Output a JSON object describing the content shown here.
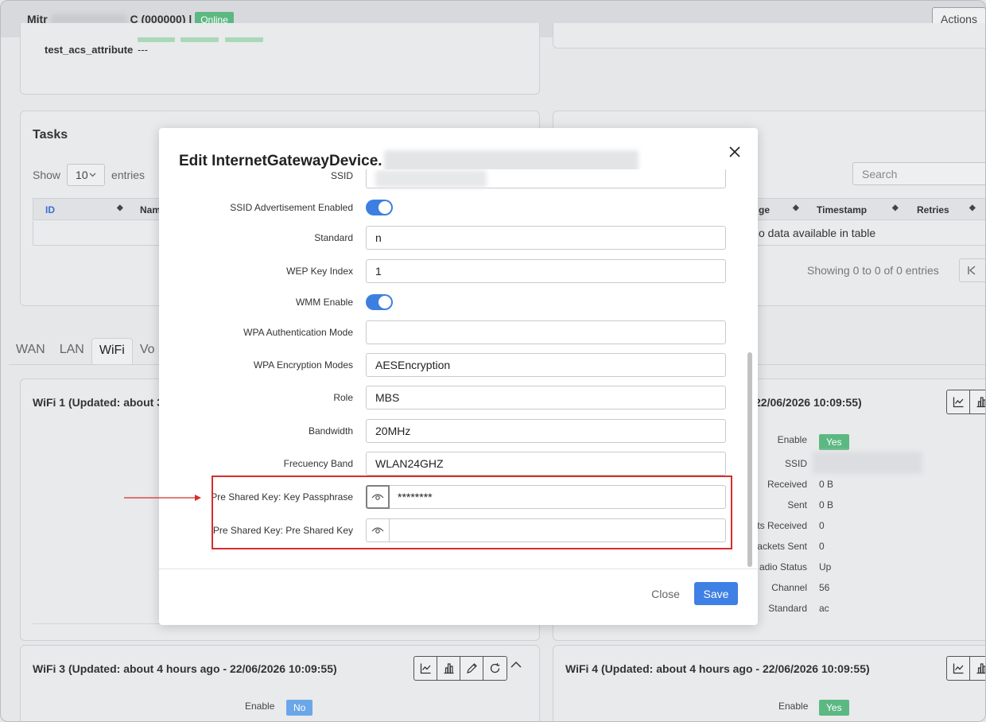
{
  "header": {
    "device_prefix": "Mitr",
    "device_suffix": "C (000000) |",
    "status_badge": "Online",
    "actions_label": "Actions"
  },
  "attributes": {
    "key": "test_acs_attribute",
    "value": "---"
  },
  "tasks": {
    "title": "Tasks",
    "show_label": "Show",
    "page_size": "10",
    "entries_label": "entries",
    "columns_left": [
      "ID",
      "Nam"
    ],
    "columns_right": [
      "ge",
      "Timestamp",
      "Retries"
    ],
    "empty_text": "o data available in table",
    "showing_text": "Showing 0 to 0 of 0 entries",
    "search_placeholder": "Search"
  },
  "tabs": [
    "WAN",
    "LAN",
    "WiFi",
    "Vo"
  ],
  "wifi1": {
    "title": "WiFi 1 (Updated: about 3",
    "title_right": "22/06/2026 10:09:55)"
  },
  "wifi2_stats": {
    "labels": [
      "Enable",
      "SSID",
      "Received",
      "Sent",
      "ts Received",
      "ackets Sent",
      "adio Status",
      "Channel",
      "Standard"
    ],
    "enable_badge": "Yes",
    "values": [
      "",
      "",
      "0 B",
      "0 B",
      "0",
      "0",
      "Up",
      "56",
      "ac"
    ]
  },
  "wifi3": {
    "title": "WiFi 3 (Updated: about 4 hours ago - 22/06/2026 10:09:55)",
    "enable_label": "Enable",
    "enable_badge": "No"
  },
  "wifi4": {
    "title": "WiFi 4 (Updated: about 4 hours ago - 22/06/2026 10:09:55)",
    "enable_label": "Enable",
    "enable_badge": "Yes"
  },
  "modal": {
    "title": "Edit InternetGatewayDevice.",
    "fields": {
      "ssid_label": "SSID",
      "ssid_adv_label": "SSID Advertisement Enabled",
      "standard_label": "Standard",
      "standard_value": "n",
      "wep_label": "WEP Key Index",
      "wep_value": "1",
      "wmm_label": "WMM Enable",
      "wpa_auth_label": "WPA Authentication Mode",
      "wpa_auth_value": "",
      "wpa_enc_label": "WPA Encryption Modes",
      "wpa_enc_value": "AESEncryption",
      "role_label": "Role",
      "role_value": "MBS",
      "bandwidth_label": "Bandwidth",
      "bandwidth_value": "20MHz",
      "freq_label": "Frecuency Band",
      "freq_value": "WLAN24GHZ",
      "psk_pass_label": "Pre Shared Key: Key Passphrase",
      "psk_pass_value": "********",
      "psk_label": "Pre Shared Key: Pre Shared Key",
      "psk_value": ""
    },
    "close_label": "Close",
    "save_label": "Save"
  },
  "colors": {
    "accent": "#3e80e4",
    "badge_green": "#5cb882",
    "badge_blue": "#6ba7e8",
    "highlight": "#d82c2c"
  },
  "icons": [
    "close-icon",
    "eye-icon",
    "chart-line-icon",
    "bar-chart-icon",
    "pencil-icon",
    "refresh-icon",
    "chevron-up-icon",
    "first-page-icon",
    "chevron-down-icon",
    "search-icon",
    "sort-icon"
  ]
}
